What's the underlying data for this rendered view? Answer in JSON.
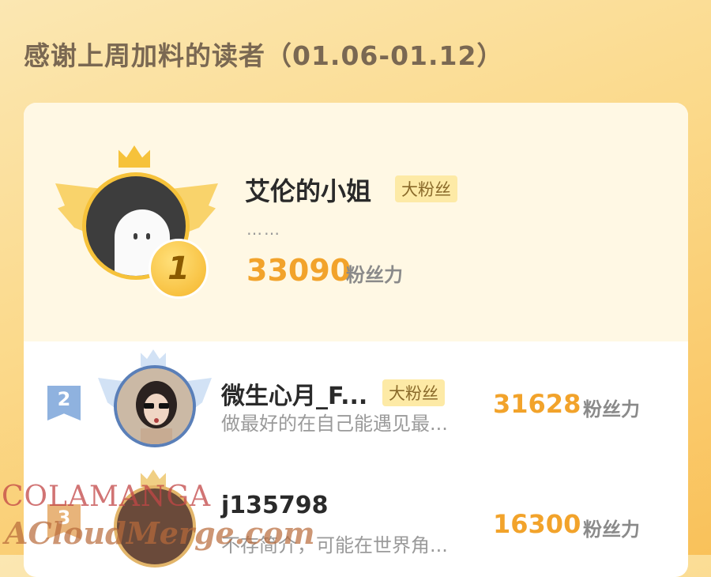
{
  "page": {
    "title": "感谢上周加料的读者（01.06-01.12）"
  },
  "leaderboard": {
    "entries": [
      {
        "rank": "1",
        "name": "艾伦的小姐",
        "badge": "大粉丝",
        "description": "……",
        "score": "33090",
        "score_unit": "粉丝力"
      },
      {
        "rank": "2",
        "name": "微生心月_F...",
        "badge": "大粉丝",
        "description": "做最好的在自己能遇见最...",
        "score": "31628",
        "score_unit": "粉丝力"
      },
      {
        "rank": "3",
        "name": "j135798",
        "badge": "",
        "description": "不存简介，可能在世界角...",
        "score": "16300",
        "score_unit": "粉丝力"
      }
    ]
  },
  "watermark": {
    "line1": "COLAMANGA",
    "line2": "ACloudMerge.com"
  },
  "colors": {
    "accent": "#f2a32b",
    "rank2": "#8fb2df",
    "background": "#fbd98a"
  }
}
